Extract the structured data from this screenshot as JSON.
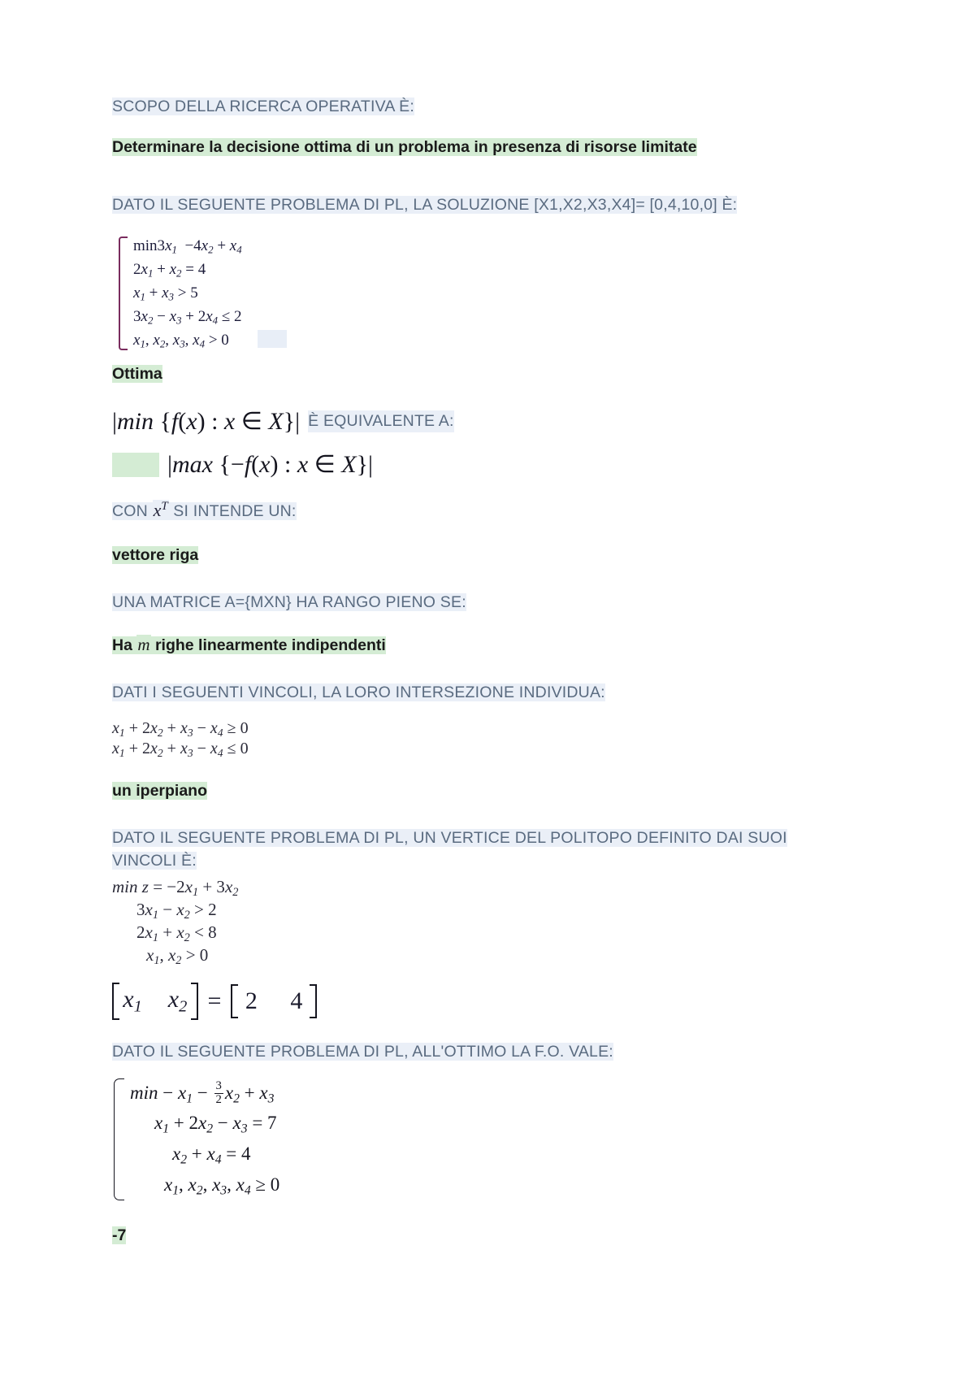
{
  "document": {
    "title": "Ricerca Operativa - Domande e Risposte",
    "colors": {
      "question_text": "#5a6b80",
      "question_highlight": "#eaeff7",
      "answer_text": "#1a1a1a",
      "answer_highlight": "#d4ecd4",
      "math_text": "#15151f",
      "brace_accent": "#7a2c5e",
      "page_background": "#ffffff"
    }
  },
  "items": [
    {
      "question": "SCOPO DELLA RICERCA OPERATIVA È:",
      "answer": "Determinare la decisione ottima di un problema in presenza di risorse limitate"
    },
    {
      "question": "DATO IL SEGUENTE PROBLEMA DI PL, LA SOLUZIONE [X1,X2,X3,X4]= [0,4,10,0] È:",
      "answer": "Ottima",
      "system": {
        "rows": [
          "min 3x₁ − 4x₂ + x₄",
          "2x₁ + x₂ = 4",
          "x₁ + x₃ ≥ 5",
          "3x₂ − x₃ + 2x₄ ≤ 2",
          "x₁, x₂, x₃, x₄ ≥ 0"
        ]
      }
    },
    {
      "question": "È EQUIVALENTE A:",
      "expression_left": "|min {f(x) : x ∈ X}|",
      "answer_expression": "|max {−f(x) : x ∈ X}|"
    },
    {
      "question_prefix": "CON",
      "question_math": "x",
      "question_math_sup": "T",
      "question_suffix": "SI INTENDE UN:",
      "answer": "vettore riga"
    },
    {
      "question": "UNA MATRICE A={MXN} HA RANGO PIENO SE:",
      "answer_prefix": "Ha",
      "answer_math": "m",
      "answer_suffix": "righe linearmente indipendenti"
    },
    {
      "question": "DATI I SEGUENTI VINCOLI, LA LORO INTERSEZIONE INDIVIDUA:",
      "constraints": [
        "x₁ + 2x₂ + x₃ − x₄ ≥ 0",
        "x₁ + 2x₂ + x₃ − x₄ ≤ 0"
      ],
      "answer": "un iperpiano"
    },
    {
      "question": "DATO IL SEGUENTE PROBLEMA DI PL, UN VERTICE DEL POLITOPO DEFINITO DAI SUOI VINCOLI È:",
      "problem": {
        "objective": "min z = −2x₁ + 3x₂",
        "constraints": [
          "3x₁ − x₂ ≥ 2",
          "2x₁ + x₂ ≤ 8",
          "x₁, x₂ ≥ 0"
        ]
      },
      "answer_matrix": {
        "lhs": [
          "x₁",
          "x₂"
        ],
        "rhs": [
          "2",
          "4"
        ],
        "equals": "="
      }
    },
    {
      "question": "DATO IL SEGUENTE PROBLEMA DI PL, ALL'OTTIMO LA F.O. VALE:",
      "system": {
        "objective_prefix": "min − x",
        "objective": "min − x₁ − (3/2)x₂ + x₃",
        "rows": [
          "x₁ + 2x₂ − x₃ = 7",
          "x₂ + x₄ = 4",
          "x₁, x₂, x₃, x₄ ≥ 0"
        ]
      },
      "answer": "-7"
    }
  ],
  "labels": {
    "q1": "SCOPO DELLA RICERCA OPERATIVA È:",
    "a1": "Determinare la decisione ottima di un problema in presenza di risorse limitate",
    "q2": "DATO IL SEGUENTE PROBLEMA DI PL, LA SOLUZIONE [X1,X2,X3,X4]= [0,4,10,0] È:",
    "a2": "Ottima",
    "q3": "È EQUIVALENTE A:",
    "q4_prefix": "CON",
    "q4_suffix": "SI INTENDE UN:",
    "a4": "vettore riga",
    "q5": "UNA MATRICE A={MXN} HA RANGO PIENO SE:",
    "a5_prefix": "Ha",
    "a5_math": "m",
    "a5_suffix": "righe linearmente indipendenti",
    "q6": "DATI I SEGUENTI VINCOLI, LA LORO INTERSEZIONE INDIVIDUA:",
    "a6": "un iperpiano",
    "q7": "DATO IL SEGUENTE PROBLEMA DI PL, UN VERTICE DEL POLITOPO DEFINITO DAI SUOI VINCOLI È:",
    "q8": "DATO IL SEGUENTE PROBLEMA DI PL, ALL'OTTIMO LA F.O. VALE:",
    "a8": "-7"
  },
  "math": {
    "sys1_r1_a": "min 3",
    "sys1_r1_b": "− 4",
    "sys1_r1_c": "+",
    "sys1_r2": "2",
    "sys1_r3": "+",
    "sys1_r4": "3",
    "minset": "min {f(x) : x ∈ X}",
    "maxset": "max {−f(x) : x ∈ X}",
    "xT_base": "x",
    "xT_sup": "T",
    "c1": "x₁ + 2x₂ + x₃ − x₄ ≥ 0",
    "c2": "x₁ + 2x₂ + x₃ − x₄ ≤ 0",
    "p_obj": "min z = −2x₁ + 3x₂",
    "p_c1": "3x₁ − x₂ ≥ 2",
    "p_c2": "2x₁ + x₂ ≤ 8",
    "p_c3": "x₁, x₂ ≥ 0",
    "mat_l1": "x₁",
    "mat_l2": "x₂",
    "mat_eq": "=",
    "mat_r1": "2",
    "mat_r2": "4",
    "s3_r2": "x₁ + 2x₂ − x₃ = 7",
    "s3_r3": "x₂ + x₄ = 4",
    "s3_r4": "x₁, x₂, x₃, x₄ ≥ 0"
  }
}
